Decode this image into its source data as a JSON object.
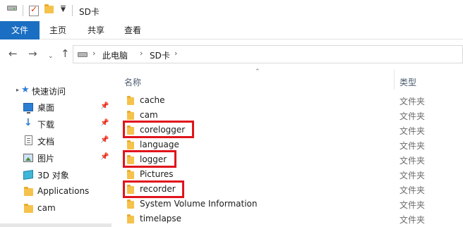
{
  "window": {
    "title": "SD卡"
  },
  "ribbon": {
    "tabs": [
      {
        "label": "文件"
      },
      {
        "label": "主页"
      },
      {
        "label": "共享"
      },
      {
        "label": "查看"
      }
    ]
  },
  "address": {
    "segments": [
      "此电脑",
      "SD卡"
    ]
  },
  "sidebar": {
    "quick_access_label": "快速访问",
    "items": [
      {
        "label": "桌面",
        "icon": "desktop-icon",
        "pinned": true
      },
      {
        "label": "下载",
        "icon": "download-icon",
        "pinned": true
      },
      {
        "label": "文档",
        "icon": "documents-icon",
        "pinned": true
      },
      {
        "label": "图片",
        "icon": "pictures-icon",
        "pinned": true
      },
      {
        "label": "3D 对象",
        "icon": "3d-objects-icon",
        "pinned": false
      },
      {
        "label": "Applications",
        "icon": "folder-icon",
        "pinned": false
      },
      {
        "label": "cam",
        "icon": "folder-icon",
        "pinned": false
      }
    ]
  },
  "columns": {
    "name": "名称",
    "type": "类型"
  },
  "files": [
    {
      "name": "cache",
      "type": "文件夹",
      "highlighted": false
    },
    {
      "name": "cam",
      "type": "文件夹",
      "highlighted": false
    },
    {
      "name": "corelogger",
      "type": "文件夹",
      "highlighted": true
    },
    {
      "name": "language",
      "type": "文件夹",
      "highlighted": false
    },
    {
      "name": "logger",
      "type": "文件夹",
      "highlighted": true
    },
    {
      "name": "Pictures",
      "type": "文件夹",
      "highlighted": false
    },
    {
      "name": "recorder",
      "type": "文件夹",
      "highlighted": true
    },
    {
      "name": "System Volume Information",
      "type": "文件夹",
      "highlighted": false
    },
    {
      "name": "timelapse",
      "type": "文件夹",
      "highlighted": false
    }
  ],
  "colors": {
    "file_tab": "#1a6fc2",
    "highlight_box": "#e0141c",
    "folder": "#f5c24c"
  }
}
